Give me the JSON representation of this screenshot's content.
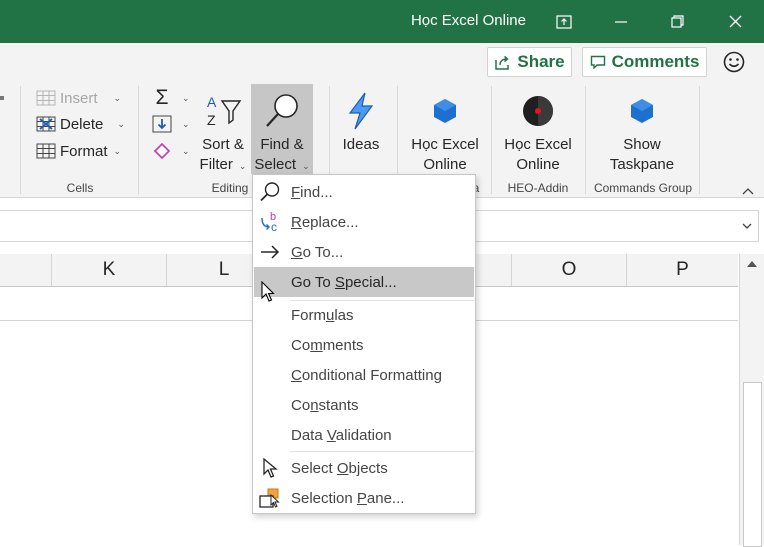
{
  "window": {
    "title": "Học Excel Online",
    "accent_color": "#217346"
  },
  "topbar": {
    "share_label": "Share",
    "comments_label": "Comments",
    "smiley_icon": "smiley-icon"
  },
  "ribbon": {
    "cells": {
      "insert_label": "Insert",
      "delete_label": "Delete",
      "format_label": "Format",
      "group_label": "Cells"
    },
    "editing": {
      "sort_filter_line1": "Sort &",
      "sort_filter_line2": "Filter",
      "find_select_line1": "Find &",
      "find_select_line2": "Select",
      "group_label": "Editing"
    },
    "ideas": {
      "label": "Ideas"
    },
    "hoc_excel_1": {
      "line1": "Học Excel",
      "line2": "Online",
      "group_partial": "a"
    },
    "hoc_excel_2": {
      "line1": "Học Excel",
      "line2": "Online",
      "group_label": "HEO-Addin"
    },
    "show_taskpane": {
      "line1": "Show",
      "line2": "Taskpane",
      "group_label": "Commands Group"
    }
  },
  "sheet": {
    "columns": [
      "K",
      "L",
      "O",
      "P"
    ]
  },
  "menu": {
    "items": [
      {
        "pre": "",
        "ul": "F",
        "post": "ind...",
        "icon": "search-icon"
      },
      {
        "pre": "",
        "ul": "R",
        "post": "eplace...",
        "icon": "replace-icon"
      },
      {
        "pre": "",
        "ul": "G",
        "post": "o To...",
        "icon": "arrow-right-icon"
      },
      {
        "pre": "Go To ",
        "ul": "S",
        "post": "pecial...",
        "icon": ""
      },
      {
        "pre": "Form",
        "ul": "u",
        "post": "las",
        "icon": ""
      },
      {
        "pre": "Co",
        "ul": "m",
        "post": "ments",
        "icon": ""
      },
      {
        "pre": "",
        "ul": "C",
        "post": "onditional Formatting",
        "icon": ""
      },
      {
        "pre": "Co",
        "ul": "n",
        "post": "stants",
        "icon": ""
      },
      {
        "pre": "Data ",
        "ul": "V",
        "post": "alidation",
        "icon": ""
      },
      {
        "pre": "Select ",
        "ul": "O",
        "post": "bjects",
        "icon": "select-objects-icon"
      },
      {
        "pre": "Selection ",
        "ul": "P",
        "post": "ane...",
        "icon": "selection-pane-icon"
      }
    ]
  }
}
